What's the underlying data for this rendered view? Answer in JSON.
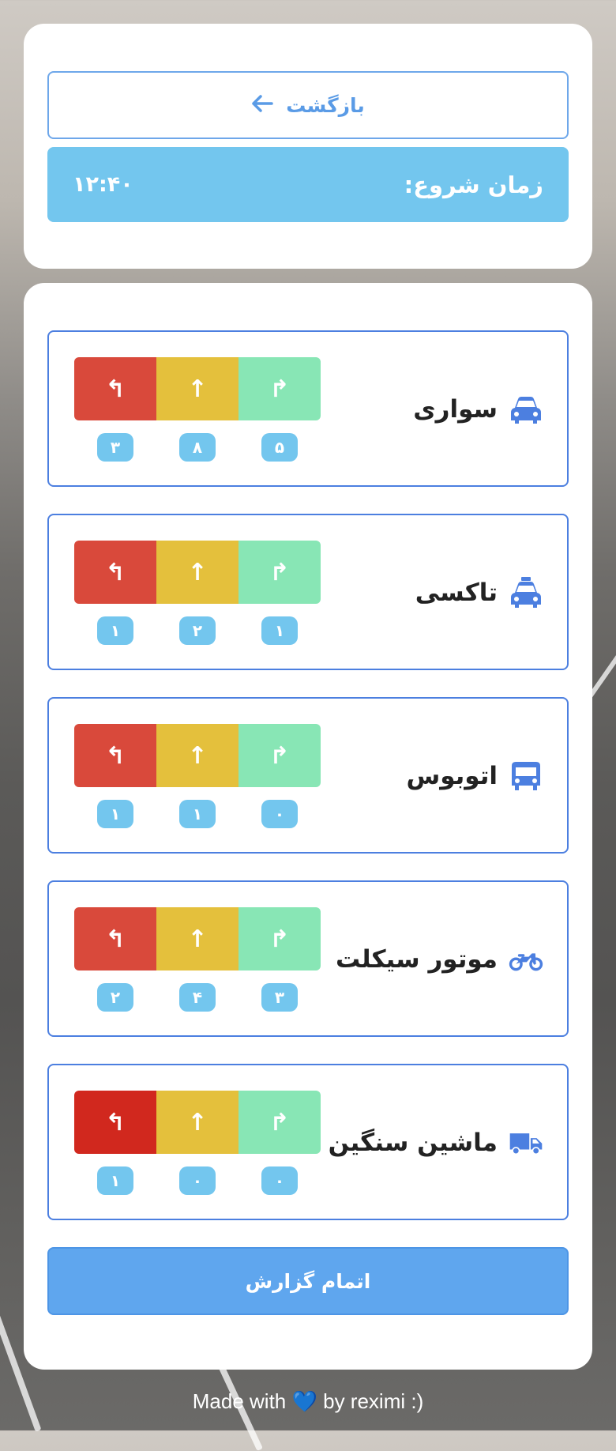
{
  "header": {
    "back_label": "بازگشت",
    "back_arrow": "🡐",
    "start_label": "زمان شروع:",
    "start_time": "۱۲:۴۰"
  },
  "vehicles": [
    {
      "name": "سواری",
      "icon": "car-icon",
      "counts": {
        "left": "۳",
        "straight": "۸",
        "right": "۵"
      }
    },
    {
      "name": "تاکسی",
      "icon": "taxi-icon",
      "counts": {
        "left": "۱",
        "straight": "۲",
        "right": "۱"
      }
    },
    {
      "name": "اتوبوس",
      "icon": "bus-icon",
      "counts": {
        "left": "۱",
        "straight": "۱",
        "right": "۰"
      }
    },
    {
      "name": "موتور سیکلت",
      "icon": "motorcycle-icon",
      "counts": {
        "left": "۲",
        "straight": "۴",
        "right": "۳"
      }
    },
    {
      "name": "ماشین سنگین",
      "icon": "truck-icon",
      "counts": {
        "left": "۱",
        "straight": "۰",
        "right": "۰"
      }
    }
  ],
  "directions": {
    "left": "↰",
    "straight": "↑",
    "right": "↱"
  },
  "finish_label": "اتمام گزارش",
  "footer": {
    "prefix": "Made with",
    "heart": "💙",
    "suffix": "by reximi :)"
  },
  "colors": {
    "accent": "#4c7fe0",
    "start_bar": "#73c6ee",
    "left": "#d9493b",
    "straight": "#e4c03c",
    "right": "#88e6b5",
    "finish": "#5fa6ee"
  }
}
